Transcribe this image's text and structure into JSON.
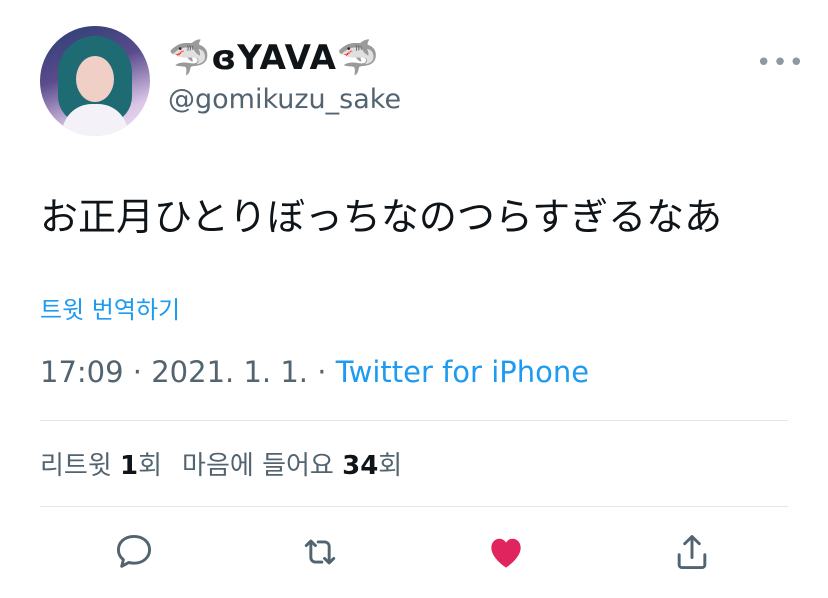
{
  "profile": {
    "display_name": "🦈ɞYAVA🦈",
    "handle": "@gomikuzu_sake"
  },
  "tweet": {
    "text": "お正月ひとりぼっちなのつらすぎるなあ",
    "translate_label": "트윗 번역하기",
    "time": "17:09",
    "separator": " · ",
    "date": "2021. 1. 1.",
    "source": "Twitter for iPhone"
  },
  "stats": {
    "retweet_label": "리트윗 ",
    "retweet_count": "1",
    "retweet_suffix": "회",
    "like_label": "마음에 들어요 ",
    "like_count": "34",
    "like_suffix": "회"
  },
  "more_label": "•••",
  "icons": {
    "reply": "comment-bubble-icon",
    "retweet": "retweet-icon",
    "like": "heart-icon",
    "share": "share-icon"
  },
  "colors": {
    "link": "#1d9bf0",
    "like_active": "#e0245e",
    "secondary_text": "#536471"
  }
}
